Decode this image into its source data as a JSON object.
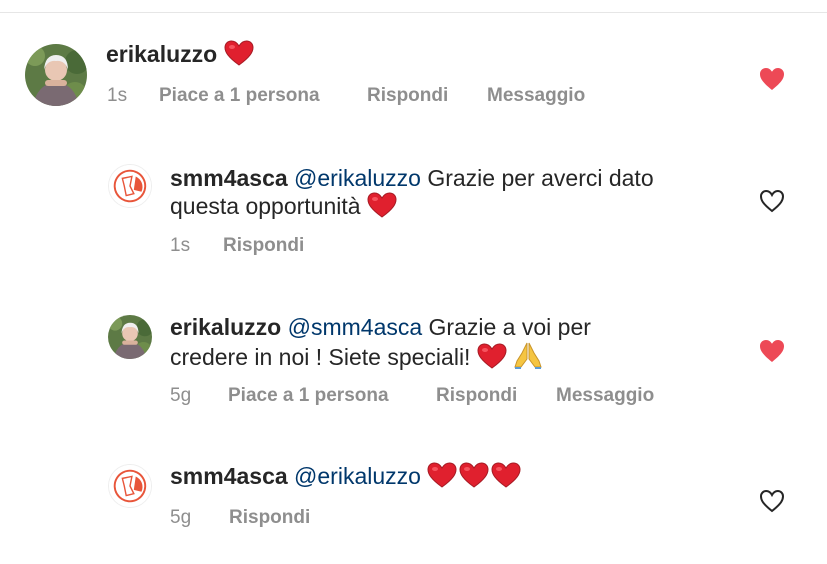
{
  "comments": [
    {
      "username": "erikaluzzo",
      "text": "",
      "time": "1s",
      "likes_label": "Piace a 1 persona",
      "reply_label": "Rispondi",
      "message_label": "Messaggio",
      "liked": true,
      "heart_color": "#ed4956"
    },
    {
      "username": "smm4asca",
      "mention": "@erikaluzzo",
      "text_line1": "Grazie per averci dato",
      "text_line2": "questa opportunità",
      "time": "1s",
      "reply_label": "Rispondi",
      "liked": false
    },
    {
      "username": "erikaluzzo",
      "mention": "@smm4asca",
      "text_line1": "Grazie a voi per",
      "text_line2": "credere in noi ! Siete speciali!",
      "time": "5g",
      "likes_label": "Piace a 1 persona",
      "reply_label": "Rispondi",
      "message_label": "Messaggio",
      "liked": true
    },
    {
      "username": "smm4asca",
      "mention": "@erikaluzzo",
      "time": "5g",
      "reply_label": "Rispondi",
      "liked": false
    }
  ],
  "colors": {
    "liked_heart": "#ed4956",
    "mention": "#00376b",
    "meta_gray": "#8e8e8e",
    "brand_orange": "#e8553a"
  },
  "icons": [
    "heart-emoji",
    "praying-hands-emoji",
    "heart-filled-icon",
    "heart-outline-icon"
  ]
}
